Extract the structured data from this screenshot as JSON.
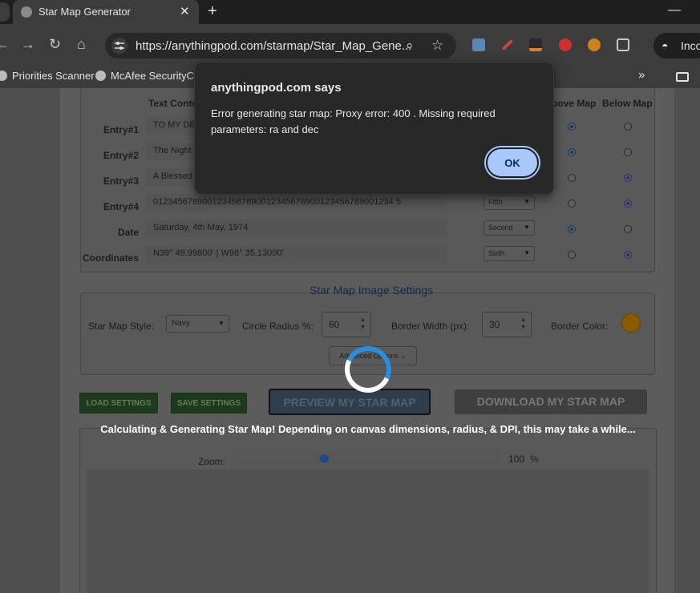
{
  "browser": {
    "tab_title": "Star Map Generator",
    "tab_close": "✕",
    "new_tab": "+",
    "window_minimize": "—",
    "url": "https://anythingpod.com/starmap/Star_Map_Gene...",
    "incognito_label": "Inco",
    "bookmarks": [
      {
        "label": "Priorities Scanner"
      },
      {
        "label": "McAfee SecurityCen"
      }
    ],
    "bookmarks_overflow": "»"
  },
  "entries_table": {
    "headers": {
      "text": "Text Conte",
      "above": "bove Map",
      "below": "Below Map"
    },
    "rows": [
      {
        "label": "Entry#1",
        "text": "TO MY DE",
        "position": "",
        "above": true,
        "below": false
      },
      {
        "label": "Entry#2",
        "text": "The Night",
        "position": "",
        "above": true,
        "below": false
      },
      {
        "label": "Entry#3",
        "text": "A Blessed",
        "position": "",
        "above": false,
        "below": true
      },
      {
        "label": "Entry#4",
        "text": "0123456789001234567890012345678900123456789001234 5",
        "position": "Fifth",
        "above": false,
        "below": true
      },
      {
        "label": "Date",
        "text": "Saturday, 4th May, 1974",
        "position": "Second",
        "above": true,
        "below": false
      },
      {
        "label": "Coordinates",
        "text": "N39° 49.99800' | W98° 35.13000'",
        "position": "Sixth",
        "above": false,
        "below": true
      }
    ]
  },
  "image_settings": {
    "title": "Star Map Image Settings",
    "style_label": "Star Map Style:",
    "style_value": "Navy",
    "radius_label": "Circle Radius %:",
    "radius_value": "60",
    "border_width_label": "Border Width (px):",
    "border_width_value": "30",
    "border_color_label": "Border Color:",
    "border_color": "#8a5a00",
    "advanced_label": "Advanced Options"
  },
  "actions": {
    "load": "LOAD SETTINGS",
    "save": "SAVE SETTINGS",
    "preview": "PREVIEW MY STAR MAP",
    "download": "DOWNLOAD MY STAR MAP"
  },
  "status_text": "Calculating & Generating Star Map! Depending on canvas dimensions, radius, & DPI, this may take a while...",
  "zoom": {
    "label": "Zoom:",
    "value": "100",
    "unit": "%",
    "slider_fraction": 0.34
  },
  "dialog": {
    "title": "anythingpod.com says",
    "message": "Error generating star map: Proxy error: 400 . Missing required parameters: ra and dec",
    "ok_label": "OK"
  },
  "colors": {
    "accent": "#a8c7fa",
    "spinner": "#2a8ee0"
  }
}
